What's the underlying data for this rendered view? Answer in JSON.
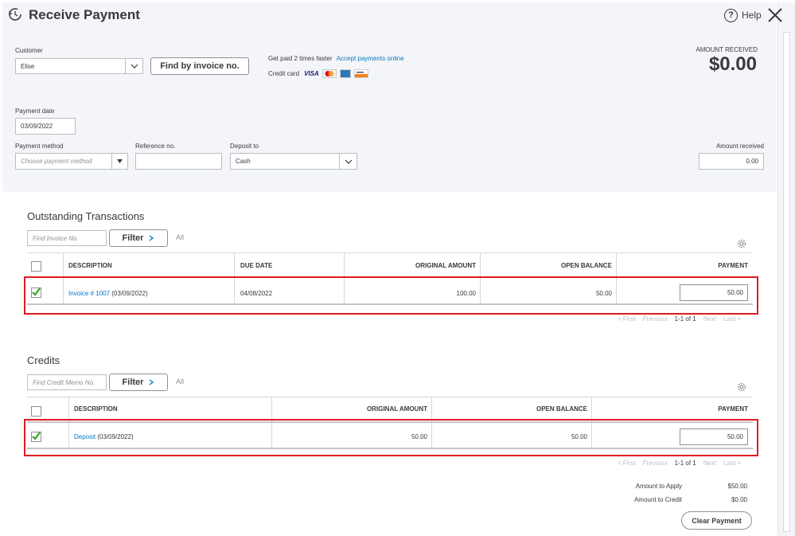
{
  "header": {
    "title": "Receive Payment",
    "help_label": "Help"
  },
  "customer": {
    "label": "Customer",
    "value": "Elise",
    "find_button": "Find by invoice no."
  },
  "promo": {
    "text": "Get paid 2 times faster",
    "link": "Accept payments online",
    "credit_card_label": "Credit card",
    "card_brands": [
      "VISA",
      "mastercard",
      "AMEX",
      "DISCOVER"
    ]
  },
  "amount_received_header": {
    "label": "AMOUNT RECEIVED",
    "value": "$0.00"
  },
  "payment_date": {
    "label": "Payment date",
    "value": "03/09/2022"
  },
  "payment_method": {
    "label": "Payment method",
    "placeholder": "Choose payment method"
  },
  "reference": {
    "label": "Reference no.",
    "value": ""
  },
  "deposit_to": {
    "label": "Deposit to",
    "value": "Cash"
  },
  "amount_received_field": {
    "label": "Amount received",
    "value": "0.00"
  },
  "outstanding": {
    "title": "Outstanding Transactions",
    "search_placeholder": "Find Invoice No.",
    "filter_label": "Filter",
    "all_label": "All",
    "columns": [
      "DESCRIPTION",
      "DUE DATE",
      "ORIGINAL AMOUNT",
      "OPEN BALANCE",
      "PAYMENT"
    ],
    "rows": [
      {
        "checked": true,
        "description_link": "Invoice # 1007",
        "description_rest": " (03/09/2022)",
        "due_date": "04/08/2022",
        "original_amount": "100.00",
        "open_balance": "50.00",
        "payment": "50.00"
      }
    ],
    "pager": {
      "first": "< First",
      "previous": "Previous",
      "range": "1-1 of 1",
      "next": "Next",
      "last": "Last >"
    }
  },
  "credits": {
    "title": "Credits",
    "search_placeholder": "Find Credit Memo No.",
    "filter_label": "Filter",
    "all_label": "All",
    "columns": [
      "DESCRIPTION",
      "ORIGINAL AMOUNT",
      "OPEN BALANCE",
      "PAYMENT"
    ],
    "rows": [
      {
        "checked": true,
        "description_link": "Deposit",
        "description_rest": " (03/09/2022)",
        "original_amount": "50.00",
        "open_balance": "50.00",
        "payment": "50.00"
      }
    ],
    "pager": {
      "first": "< First",
      "previous": "Previous",
      "range": "1-1 of 1",
      "next": "Next",
      "last": "Last >"
    }
  },
  "summary": {
    "apply_label": "Amount to Apply",
    "apply_value": "$50.00",
    "credit_label": "Amount to Credit",
    "credit_value": "$0.00",
    "clear_button": "Clear Payment"
  },
  "colors": {
    "accent_green": "#2ca01c",
    "link_blue": "#0077c5",
    "highlight_red": "#e11b22"
  }
}
